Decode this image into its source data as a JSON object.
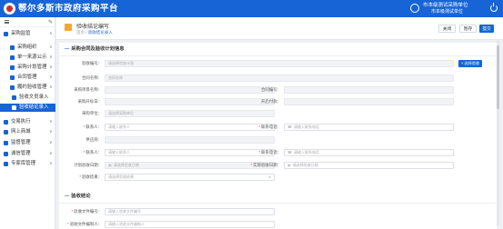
{
  "topbar": {
    "title": "鄂尔多斯市政府采购平台",
    "user_line1": "市本级测试采购单位",
    "user_line2": "市本级测试单位"
  },
  "sidebar": {
    "items": [
      {
        "label": "采购监管",
        "level": 0,
        "icon_color": "#1764d6",
        "arrow": "∧",
        "active": false
      },
      {
        "label": "采购组织",
        "level": 1,
        "icon_color": "#1764d6",
        "arrow": "∨",
        "active": false
      },
      {
        "label": "单一来源公示",
        "level": 1,
        "icon_color": "#1764d6",
        "arrow": "∨",
        "active": false
      },
      {
        "label": "采购计划管理",
        "level": 1,
        "icon_color": "#1764d6",
        "arrow": "∨",
        "active": false
      },
      {
        "label": "合同管理",
        "level": 1,
        "icon_color": "#1764d6",
        "arrow": "∨",
        "active": false
      },
      {
        "label": "履约验收管理",
        "level": 1,
        "icon_color": "#1764d6",
        "arrow": "∧",
        "active": false
      },
      {
        "label": "验收文员录入",
        "level": 2,
        "icon_color": "#1764d6",
        "arrow": "",
        "active": false
      },
      {
        "label": "验收结论录入",
        "level": 2,
        "icon_color": "#ffffff",
        "arrow": "",
        "active": true
      },
      {
        "label": "交易执行",
        "level": 0,
        "icon_color": "#1764d6",
        "arrow": "∨",
        "active": false
      },
      {
        "label": "网上商城",
        "level": 0,
        "icon_color": "#1764d6",
        "arrow": "∨",
        "active": false
      },
      {
        "label": "监督管理",
        "level": 0,
        "icon_color": "#1764d6",
        "arrow": "∨",
        "active": false
      },
      {
        "label": "诚信管理",
        "level": 0,
        "icon_color": "#1764d6",
        "arrow": "∨",
        "active": false
      },
      {
        "label": "专家库管理",
        "level": 0,
        "icon_color": "#1764d6",
        "arrow": "∨",
        "active": false
      }
    ]
  },
  "header": {
    "title": "验收结论编写",
    "breadcrumb_home": "首页",
    "breadcrumb_sep": "/",
    "breadcrumb_current": "验收结论录入",
    "buttons": {
      "back": "关闭",
      "save": "暂存",
      "submit": "提交"
    }
  },
  "section1": {
    "title": "采购合同及验收计划信息",
    "rows": [
      {
        "fields": [
          {
            "label": "验收编号：",
            "value": "请选择验收计划",
            "required": false,
            "white": false,
            "icon": "",
            "chev": false,
            "span": "full"
          }
        ],
        "button": "+ 选择验收"
      },
      {
        "fields": [
          {
            "label": "合同名称：",
            "value": "合同名称",
            "required": false,
            "white": false,
            "icon": "",
            "chev": false,
            "span": "full"
          }
        ]
      },
      {
        "fields": [
          {
            "label": "采购项目名称：",
            "value": "",
            "required": false,
            "white": false,
            "icon": "",
            "chev": false,
            "span": "half"
          },
          {
            "label": "合同编号：",
            "value": "",
            "required": false,
            "white": false,
            "icon": "",
            "chev": false,
            "span": "half"
          }
        ]
      },
      {
        "fields": [
          {
            "label": "采购开标日：",
            "value": "",
            "required": false,
            "white": false,
            "icon": "",
            "chev": false,
            "span": "half"
          },
          {
            "label": "开启付款：",
            "value": "",
            "required": false,
            "white": false,
            "icon": "",
            "chev": false,
            "span": "half"
          }
        ]
      },
      {
        "fields": [
          {
            "label": "采购单位：",
            "value": "请选择采购单位",
            "required": false,
            "white": false,
            "icon": "",
            "chev": false,
            "span": "half"
          }
        ]
      },
      {
        "fields": [
          {
            "label": "联系人：",
            "value": "请输入联系人",
            "required": true,
            "white": true,
            "icon": "",
            "chev": false,
            "span": "half"
          },
          {
            "label": "联系电话：",
            "value": "请输入联系电话",
            "required": true,
            "white": true,
            "icon": "☎",
            "chev": false,
            "span": "half"
          }
        ]
      },
      {
        "fields": [
          {
            "label": "供应商：",
            "value": "",
            "required": false,
            "white": false,
            "icon": "",
            "chev": false,
            "span": "half"
          }
        ]
      },
      {
        "fields": [
          {
            "label": "联系人：",
            "value": "请输入联系人",
            "required": true,
            "white": true,
            "icon": "",
            "chev": false,
            "span": "half"
          },
          {
            "label": "联系电话：",
            "value": "请输入联系电话",
            "required": true,
            "white": true,
            "icon": "☎",
            "chev": false,
            "span": "half"
          }
        ]
      },
      {
        "fields": [
          {
            "label": "计划验收日期：",
            "value": "请选择验收日期",
            "required": false,
            "white": false,
            "icon": "▣",
            "chev": false,
            "span": "half"
          },
          {
            "label": "实际验收日期：",
            "value": "请选择验收日期",
            "required": true,
            "white": true,
            "icon": "▣",
            "chev": false,
            "span": "half"
          }
        ]
      },
      {
        "fields": [
          {
            "label": "验收结果：",
            "value": "请选择验收结果",
            "required": true,
            "white": true,
            "icon": "",
            "chev": true,
            "span": "half"
          }
        ]
      }
    ]
  },
  "section2": {
    "title": "验收结论",
    "rows": [
      {
        "fields": [
          {
            "label": "验收文件编号：",
            "value": "请输入验收文件编号",
            "required": true,
            "white": true,
            "icon": "",
            "chev": false,
            "span": "half"
          }
        ]
      },
      {
        "fields": [
          {
            "label": "验收文件编制人：",
            "value": "请输入验收文件编制人",
            "required": true,
            "white": true,
            "icon": "",
            "chev": false,
            "span": "half"
          }
        ]
      }
    ]
  }
}
